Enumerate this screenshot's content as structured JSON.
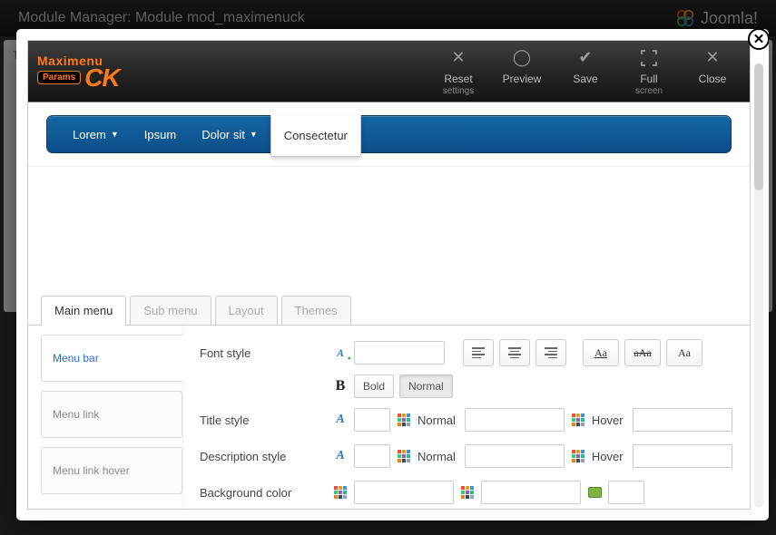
{
  "backdrop": {
    "title": "Module Manager: Module mod_maximenuck",
    "brand": "Joomla!",
    "sidebar_stub": "Title"
  },
  "toolbar": {
    "logo_line1": "Maximenu",
    "logo_params": "Params",
    "logo_ck": "CK",
    "reset": "Reset",
    "reset_sub": "settings",
    "preview": "Preview",
    "save": "Save",
    "full": "Full",
    "full_sub": "screen",
    "close": "Close"
  },
  "preview_menu": {
    "items": [
      {
        "label": "Lorem",
        "dropdown": true
      },
      {
        "label": "Ipsum",
        "dropdown": false
      },
      {
        "label": "Dolor sit",
        "dropdown": true
      },
      {
        "label": "Consectetur",
        "dropdown": false,
        "active": true
      }
    ]
  },
  "tabs": {
    "main": "Main menu",
    "sub": "Sub menu",
    "layout": "Layout",
    "themes": "Themes"
  },
  "side_tabs": {
    "menu_bar": "Menu bar",
    "menu_link": "Menu link",
    "menu_link_hover": "Menu link hover"
  },
  "form": {
    "font_style": "Font style",
    "title_style": "Title style",
    "desc_style": "Description style",
    "bg_color": "Background color",
    "bold": "Bold",
    "normal": "Normal",
    "normal_label": "Normal",
    "hover_label": "Hover",
    "aa_underline": "Aa",
    "aa_strike": "aAa",
    "aa_plain": "Aa"
  }
}
